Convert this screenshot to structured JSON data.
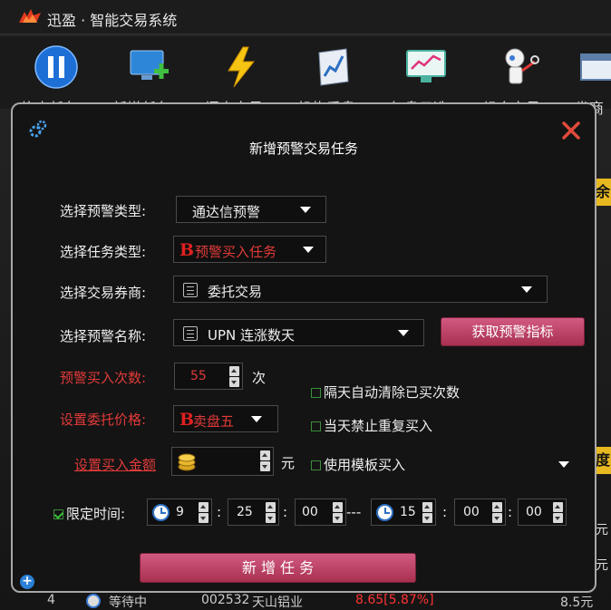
{
  "app": {
    "title": "迅盈 · 智能交易系统",
    "toolbar": [
      {
        "label": "停止任务",
        "icon": "pause-icon"
      },
      {
        "label": "新增任务",
        "icon": "monitor-add-icon"
      },
      {
        "label": "闪电交易",
        "icon": "lightning-icon"
      },
      {
        "label": "机构看盘",
        "icon": "book-chart-icon"
      },
      {
        "label": "复盘云选",
        "icon": "screen-chart-icon"
      },
      {
        "label": "组合交易",
        "icon": "robot-icon"
      },
      {
        "label": "券商",
        "icon": "window-icon"
      }
    ],
    "side_tags": [
      "余",
      "度"
    ],
    "side_cells": [
      "元",
      "元"
    ],
    "bottom_row": {
      "index": "4",
      "status": "等待中",
      "code": "002532",
      "name": "天山铝业",
      "price": "8.65[5.87%]",
      "amount": "8.5元"
    }
  },
  "dialog": {
    "title": "新增预警交易任务",
    "alert_type": {
      "label": "选择预警类型:",
      "value": "通达信预警"
    },
    "task_type": {
      "label": "选择任务类型:",
      "badge": "B",
      "value": "预警买入任务"
    },
    "broker": {
      "label": "选择交易券商:",
      "value": "委托交易"
    },
    "alert_name": {
      "label": "选择预警名称:",
      "value": "UPN 连涨数天"
    },
    "fetch_button": "获取预警指标",
    "buy_count": {
      "label": "预警买入次数:",
      "value": "55",
      "unit": "次"
    },
    "price": {
      "label": "设置委托价格:",
      "badge": "B",
      "value": "卖盘五"
    },
    "amount": {
      "label": "设置买入金额",
      "value": "",
      "unit": "元"
    },
    "options": [
      {
        "label": "隔天自动清除已买次数",
        "checked": false
      },
      {
        "label": "当天禁止重复买入",
        "checked": false
      },
      {
        "label": "使用模板买入",
        "checked": false
      }
    ],
    "time_limit": {
      "label": "限定时间:",
      "checked": true,
      "start": {
        "h": "9",
        "m": "25",
        "s": "00"
      },
      "separator": "---",
      "end": {
        "h": "15",
        "m": "00",
        "s": "00"
      },
      "colon": ":"
    },
    "submit_button": "新 增 任 务",
    "plus": "+"
  }
}
